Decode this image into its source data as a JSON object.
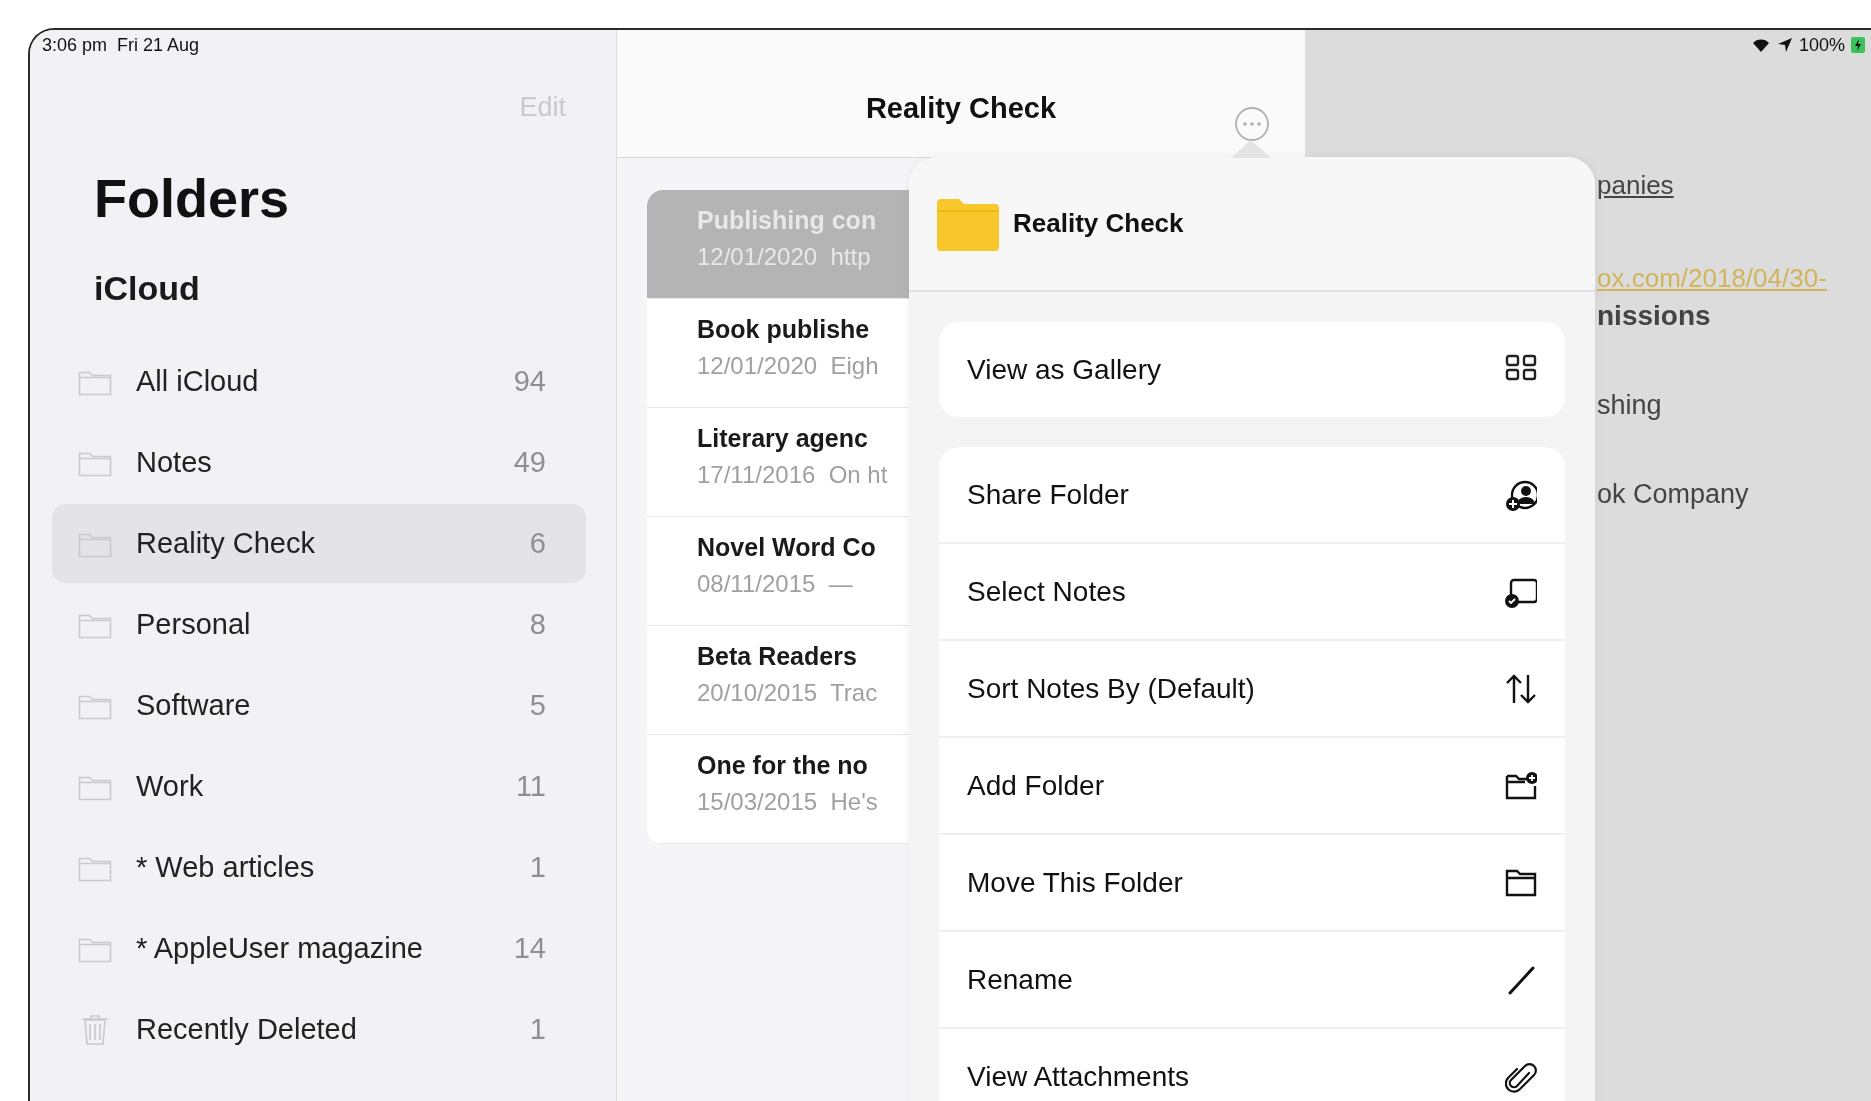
{
  "status_bar": {
    "time": "3:06 pm",
    "date": "Fri 21 Aug",
    "battery": "100%"
  },
  "sidebar": {
    "edit": "Edit",
    "title": "Folders",
    "section": "iCloud",
    "folders": [
      {
        "kind": "folder",
        "name": "All iCloud",
        "count": "94",
        "selected": false
      },
      {
        "kind": "folder",
        "name": "Notes",
        "count": "49",
        "selected": false
      },
      {
        "kind": "folder",
        "name": "Reality Check",
        "count": "6",
        "selected": true
      },
      {
        "kind": "folder",
        "name": "Personal",
        "count": "8",
        "selected": false
      },
      {
        "kind": "folder",
        "name": "Software",
        "count": "5",
        "selected": false
      },
      {
        "kind": "folder",
        "name": "Work",
        "count": "11",
        "selected": false
      },
      {
        "kind": "folder",
        "name": "* Web articles",
        "count": "1",
        "selected": false
      },
      {
        "kind": "folder",
        "name": "* AppleUser magazine",
        "count": "14",
        "selected": false
      },
      {
        "kind": "trash",
        "name": "Recently Deleted",
        "count": "1",
        "selected": false
      }
    ]
  },
  "note_list": {
    "title": "Reality Check",
    "notes": [
      {
        "title": "Publishing con",
        "date": "12/01/2020",
        "preview": "http",
        "selected": true
      },
      {
        "title": "Book publishe",
        "date": "12/01/2020",
        "preview": "Eigh",
        "selected": false
      },
      {
        "title": "Literary agenc",
        "date": "17/11/2016",
        "preview": "On ht",
        "selected": false
      },
      {
        "title": "Novel Word Co",
        "date": "08/11/2015",
        "preview": "—",
        "selected": false
      },
      {
        "title": "Beta Readers",
        "date": "20/10/2015",
        "preview": "Trac",
        "selected": false
      },
      {
        "title": "One for the no",
        "date": "15/03/2015",
        "preview": "He's",
        "selected": false
      }
    ]
  },
  "note_detail": {
    "lines": [
      {
        "kind": "underlined",
        "text": "panies"
      },
      {
        "kind": "link",
        "text": "ox.com/2018/04/30-"
      },
      {
        "kind": "heading",
        "text": "nissions"
      },
      {
        "kind": "text",
        "text": "shing"
      },
      {
        "kind": "text",
        "text": "ok Company"
      }
    ]
  },
  "menu": {
    "title": "Reality Check",
    "groups": [
      [
        {
          "kind": "gallery",
          "label": "View as Gallery"
        }
      ],
      [
        {
          "kind": "share",
          "label": "Share Folder"
        },
        {
          "kind": "select",
          "label": "Select Notes"
        },
        {
          "kind": "sort",
          "label": "Sort Notes By (Default)"
        },
        {
          "kind": "addfolder",
          "label": "Add Folder"
        },
        {
          "kind": "move",
          "label": "Move This Folder"
        },
        {
          "kind": "rename",
          "label": "Rename"
        },
        {
          "kind": "attachments",
          "label": "View Attachments"
        }
      ]
    ]
  }
}
